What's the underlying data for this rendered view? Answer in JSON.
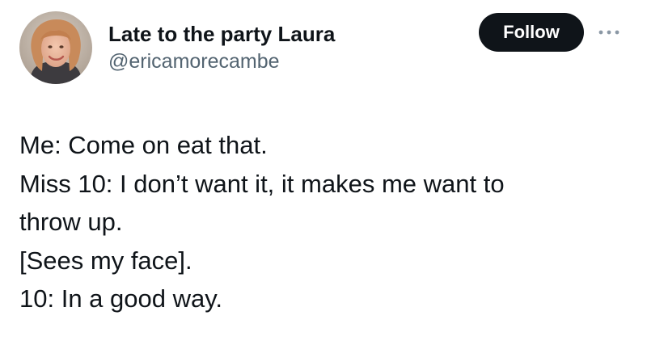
{
  "colors": {
    "text_primary": "#0f1419",
    "text_secondary": "#536471",
    "follow_button_bg": "#0f1419",
    "follow_button_text": "#ffffff",
    "background": "#ffffff"
  },
  "author": {
    "display_name": "Late to the party Laura",
    "handle": "@ericamorecambe",
    "avatar_icon": "profile-photo"
  },
  "actions": {
    "follow_label": "Follow",
    "more_icon": "more-dots-icon"
  },
  "tweet": {
    "lines": [
      "Me: Come on eat that.",
      "Miss 10: I don’t want it, it makes me want to",
      "throw up.",
      "[Sees my face].",
      "10: In a good way."
    ]
  }
}
